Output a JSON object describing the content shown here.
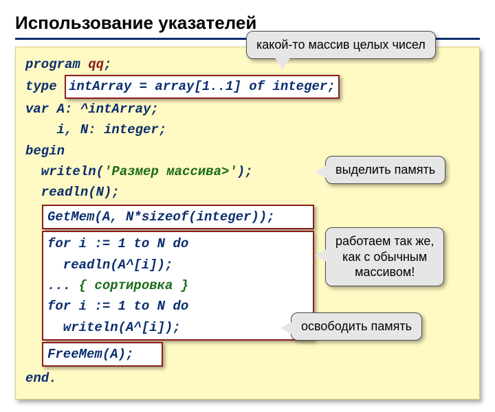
{
  "title": "Использование указателей",
  "code": {
    "l1a": "program ",
    "l1b": "qq",
    "l1c": ";",
    "l2a": "type ",
    "l2_hl": "intArray = array[1..1] of integer;",
    "l3": "var A: ^intArray;",
    "l4": "    i, N: integer;",
    "l5": "begin",
    "l6a": "  writeln(",
    "l6b": "'Размер массива>'",
    "l6c": ");",
    "l7": "  readln(N);",
    "l8_hl": "GetMem(A, N*sizeof(integer));",
    "box2_l1": "for i := 1 to N do",
    "box2_l2": "  readln(A^[i]);",
    "box2_l3a": "... ",
    "box2_l3b": "{ сортировка }",
    "box2_l4": "for i := 1 to N do",
    "box2_l5": "  writeln(A^[i]);",
    "l14_hl": "FreeMem(A);",
    "l15": "end."
  },
  "callouts": {
    "c1": "какой-то массив целых чисел",
    "c2": "выделить память",
    "c3a": "работаем так же,",
    "c3b": "как с обычным",
    "c3c": "массивом!",
    "c4": "освободить память"
  }
}
